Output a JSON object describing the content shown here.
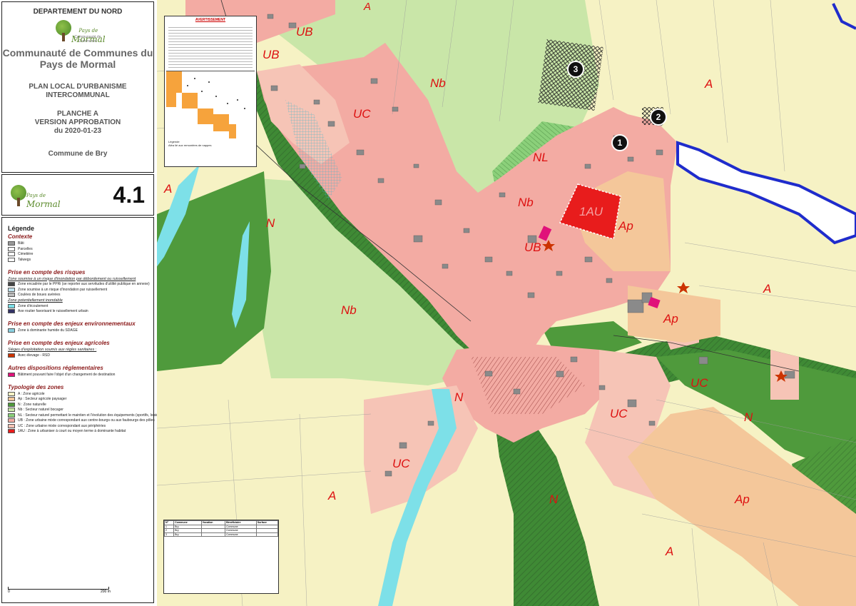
{
  "title_block": {
    "department": "DEPARTEMENT DU NORD",
    "logo_text": "Mormal",
    "logo_prefix": "Pays de",
    "logo_sub": "Communauté de Communes",
    "community": "Communauté de Communes du Pays de Mormal",
    "plan_name": "PLAN LOCAL D'URBANISME INTERCOMMUNAL",
    "sheet": "PLANCHE A",
    "version": "VERSION APPROBATION",
    "date": "du 2020-01-23",
    "commune": "Commune de Bry"
  },
  "plate_number": "4.1",
  "legend": {
    "title": "Légende",
    "context_title": "Contexte",
    "context": [
      {
        "label": "Bâti",
        "color": "#999999"
      },
      {
        "label": "Parcelles",
        "color": "#ffffff"
      },
      {
        "label": "Cimetière",
        "color": "#ffffff"
      },
      {
        "label": "Talwegs",
        "color": "#ffffff"
      }
    ],
    "risks_title": "Prise en compte des risques",
    "risks_sub": "Zone soumise à un risque d'inondation par débordement ou ruissellement",
    "risks": [
      {
        "label": "Zone encadrée par le PPRi (se reporter aux servitudes d'utilité publique en annexe)",
        "color": "#444444"
      },
      {
        "label": "Zone soumise à un risque d'inondation par ruissellement",
        "color": "#bfe4f0"
      },
      {
        "label": "Coulées de boues avérées",
        "color": "#bbbbbb"
      }
    ],
    "flood_sub": "Zone potentiellement inondable",
    "flood": [
      {
        "label": "Zone d'écoulement",
        "color": "#7de0e8"
      },
      {
        "label": "Axe routier favorisant le ruissellement urbain",
        "color": "#333366"
      }
    ],
    "env_title": "Prise en compte des enjeux environnementaux",
    "env": [
      {
        "label": "Zone à dominante humide du SDAGE",
        "color": "#8ad0e0"
      }
    ],
    "agri_title": "Prise en compte des enjeux agricoles",
    "agri_sub": "Sièges d'exploitation soumis aux règles sanitaires :",
    "agri": [
      {
        "label": "Avec élevage - RSD",
        "color": "#cc3300"
      }
    ],
    "other_title": "Autres dispositions réglementaires",
    "other": [
      {
        "label": "Bâtiment pouvant faire l'objet d'un changement de destination",
        "color": "#e0127a"
      }
    ],
    "zones_title": "Typologie des zones",
    "zones": [
      {
        "label": "A : Zone agricole",
        "color": "#f6f2c4"
      },
      {
        "label": "Ap : Secteur agricole paysager",
        "color": "#f4c79a"
      },
      {
        "label": "N : Zone naturelle",
        "color": "#4f9a3c"
      },
      {
        "label": "Nb : Secteur naturel bocager",
        "color": "#c9e6a8"
      },
      {
        "label": "NL : Secteur naturel permettant le maintien et l'évolution des équipements (sportifs, loisirs ...)",
        "color": "#8bd07a"
      },
      {
        "label": "UB : Zone urbaine mixte correspondant aux centre-bourgs ou aux faubourgs des pôles",
        "color": "#f3aba3"
      },
      {
        "label": "UC : Zone urbaine mixte correspondant aux périphéries",
        "color": "#f6c4b6"
      },
      {
        "label": "1AU : Zone à urbaniser à court ou moyen terme à dominante habitat",
        "color": "#e81c1c"
      }
    ]
  },
  "scale_bar": {
    "start": "0",
    "end": "200 m"
  },
  "notice": {
    "header": "AVERTISSEMENT",
    "legend_title": "Légende",
    "legend_sub": "Aléa lié aux remontées de nappes"
  },
  "zone_labels": {
    "ub1": "UB",
    "ub2": "UB",
    "ub3": "UB",
    "uc1": "UC",
    "uc2": "UC",
    "uc3": "UC",
    "uc4": "UC",
    "nb1": "Nb",
    "nb2": "Nb",
    "nb3": "Nb",
    "nl": "NL",
    "a1": "A",
    "a2": "A",
    "a3": "A",
    "a4": "A",
    "a5": "A",
    "a6": "A",
    "ap1": "Ap",
    "ap2": "Ap",
    "ap3": "Ap",
    "n1": "N",
    "n2": "N",
    "n3": "N",
    "n4": "N",
    "au": "1AU"
  },
  "markers": [
    "1",
    "2",
    "3"
  ],
  "table": {
    "headers": [
      "N°",
      "Commune",
      "Vocation",
      "Bénéficiaire",
      "Surface"
    ],
    "rows": [
      [
        "1",
        "Bry",
        "",
        "Commune",
        ""
      ],
      [
        "2",
        "Bry",
        "",
        "Commune",
        ""
      ],
      [
        "3",
        "Bry",
        "",
        "Commune",
        ""
      ]
    ]
  },
  "colors": {
    "agri": "#f6f2c4",
    "ub": "#f3aba3",
    "uc": "#f6c4b6",
    "nb": "#c9e6a8",
    "n": "#4f9a3c",
    "nl": "#8bd07a",
    "ap": "#f4c79a",
    "au": "#e81c1c",
    "label": "#dd1111",
    "boundary": "#1f2ccc"
  }
}
